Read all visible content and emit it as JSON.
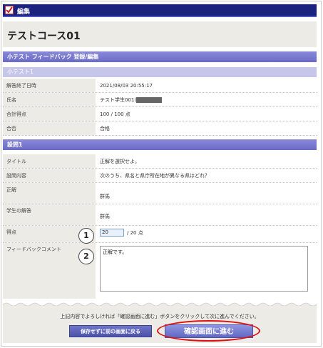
{
  "header": {
    "title": "編集"
  },
  "course": {
    "title": "テストコース01"
  },
  "section_feedback": {
    "title": "小テスト フィードバック 登録/編集"
  },
  "quiz": {
    "title": "小テスト1",
    "rows": [
      {
        "label": "解答終了日時",
        "value": "2021/08/03 20:55:17"
      },
      {
        "label": "氏名",
        "value": "テスト学生001("
      },
      {
        "label": "合計得点",
        "value": "100 / 100 点"
      },
      {
        "label": "合否",
        "value": "合格"
      }
    ]
  },
  "question": {
    "title": "設問1",
    "title_label": "タイトル",
    "title_value": "正解を選択せよ。",
    "content_label": "設問内容",
    "content_value": "次のうち、県名と県庁所在地が異なる県はどれ？",
    "answer_label": "正解",
    "answer_value": "群馬",
    "student_label": "学生の解答",
    "student_value": "群馬",
    "score_label": "得点",
    "score_value": "20",
    "score_suffix": "/ 20 点",
    "feedback_label": "フィードバックコメント",
    "feedback_value": "正解です。"
  },
  "callouts": {
    "one": "1",
    "two": "2"
  },
  "footer": {
    "message": "上記内容でよろしければ「確認画面に進む」ボタンをクリックして次に進んでください。",
    "back_button": "保存せずに前の画面に戻る",
    "next_button": "確認画面に進む"
  }
}
